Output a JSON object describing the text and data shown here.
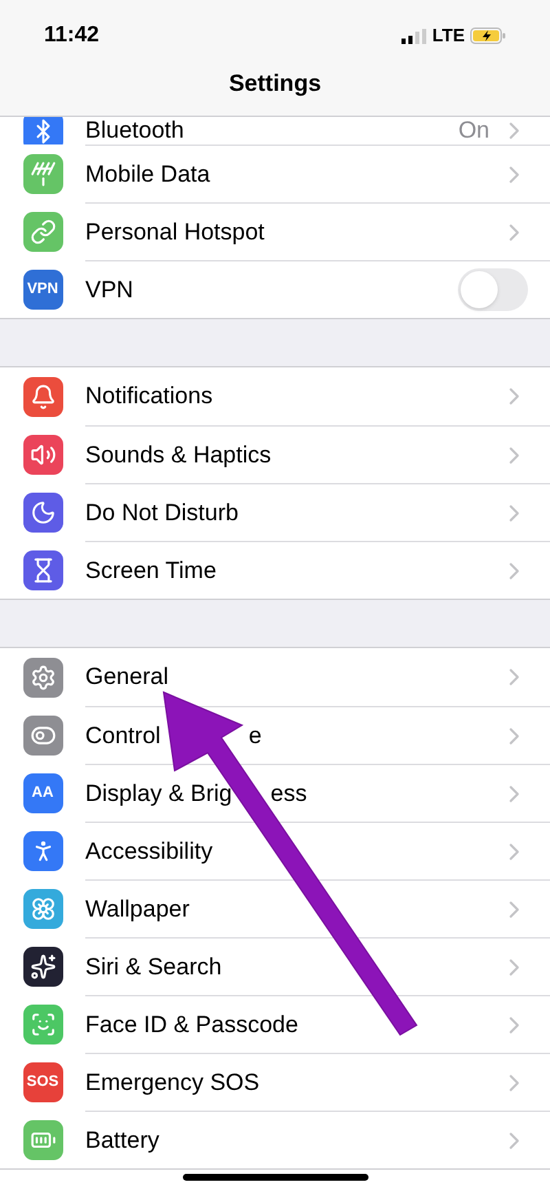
{
  "status_bar": {
    "time": "11:42",
    "network": "LTE"
  },
  "title": "Settings",
  "sections": [
    {
      "rows": [
        {
          "kind": "value",
          "label": "Bluetooth",
          "value": "On",
          "color": "#3478f6"
        },
        {
          "kind": "link",
          "label": "Mobile Data",
          "color": "#65c466"
        },
        {
          "kind": "link",
          "label": "Personal Hotspot",
          "color": "#65c466"
        },
        {
          "kind": "toggle",
          "label": "VPN",
          "icon_text": "VPN",
          "on": false,
          "color": "#2f6fd6"
        }
      ]
    },
    {
      "rows": [
        {
          "kind": "link",
          "label": "Notifications",
          "color": "#eb4d3d"
        },
        {
          "kind": "link",
          "label": "Sounds & Haptics",
          "color": "#eb445a"
        },
        {
          "kind": "link",
          "label": "Do Not Disturb",
          "color": "#5e5ce6"
        },
        {
          "kind": "link",
          "label": "Screen Time",
          "color": "#5e5ce6"
        }
      ]
    },
    {
      "rows": [
        {
          "kind": "link",
          "label": "General",
          "color": "#8e8e93"
        },
        {
          "kind": "link",
          "label": "Control",
          "label_tail": "e",
          "color": "#8e8e93"
        },
        {
          "kind": "link",
          "label": "Display & Brig",
          "label_tail": "ess",
          "icon_text": "AA",
          "color": "#3478f6"
        },
        {
          "kind": "link",
          "label": "Accessibility",
          "color": "#3478f6"
        },
        {
          "kind": "link",
          "label": "Wallpaper",
          "color": "#34aadc"
        },
        {
          "kind": "link",
          "label": "Siri & Search",
          "color": "#222233"
        },
        {
          "kind": "link",
          "label": "Face ID & Passcode",
          "color": "#4cc764"
        },
        {
          "kind": "link",
          "label": "Emergency SOS",
          "icon_text": "SOS",
          "color": "#e7413a"
        },
        {
          "kind": "link",
          "label": "Battery",
          "color": "#65c466"
        }
      ]
    }
  ]
}
